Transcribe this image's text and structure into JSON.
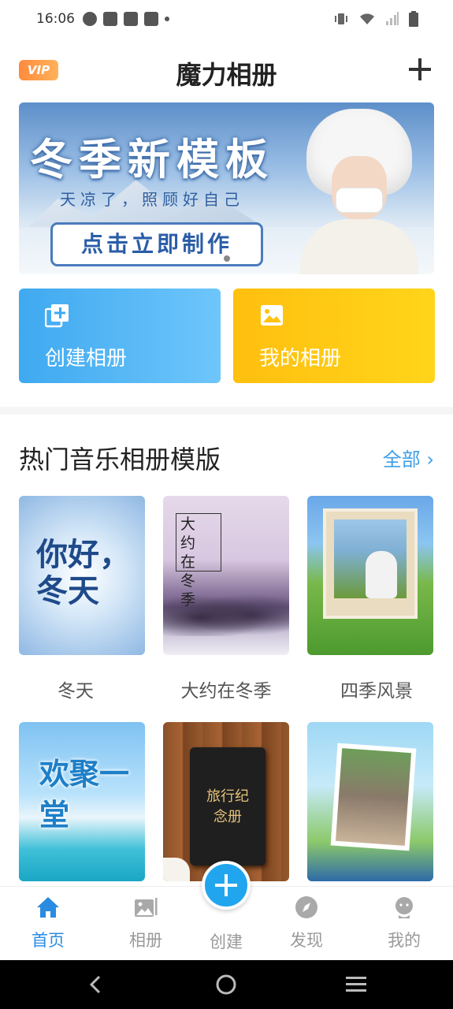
{
  "status_bar": {
    "time": "16:06"
  },
  "header": {
    "vip_label": "VIP",
    "title": "魔力相册"
  },
  "banner": {
    "title": "冬季新模板",
    "subtitle": "天凉了，照顾好自己",
    "cta": "点击立即制作"
  },
  "actions": {
    "create_label": "创建相册",
    "mine_label": "我的相册"
  },
  "section": {
    "title": "热门音乐相册模版",
    "see_all": "全部"
  },
  "templates": [
    {
      "caption": "冬天",
      "art": "你好，冬天"
    },
    {
      "caption": "大约在冬季",
      "art": "大约在冬季"
    },
    {
      "caption": "四季风景"
    },
    {
      "art": "欢聚一堂"
    },
    {
      "art": "旅行纪念册"
    },
    {}
  ],
  "bottom_nav": {
    "items": [
      {
        "label": "首页",
        "icon": "home-icon",
        "active": true
      },
      {
        "label": "相册",
        "icon": "album-icon"
      },
      {
        "label": "创建",
        "icon": "plus-icon"
      },
      {
        "label": "发现",
        "icon": "compass-icon"
      },
      {
        "label": "我的",
        "icon": "user-icon"
      }
    ]
  },
  "colors": {
    "accent": "#22a5ef",
    "create_card": "#3fa9f0",
    "mine_card": "#ffc20f",
    "active_nav": "#2a8be0"
  }
}
